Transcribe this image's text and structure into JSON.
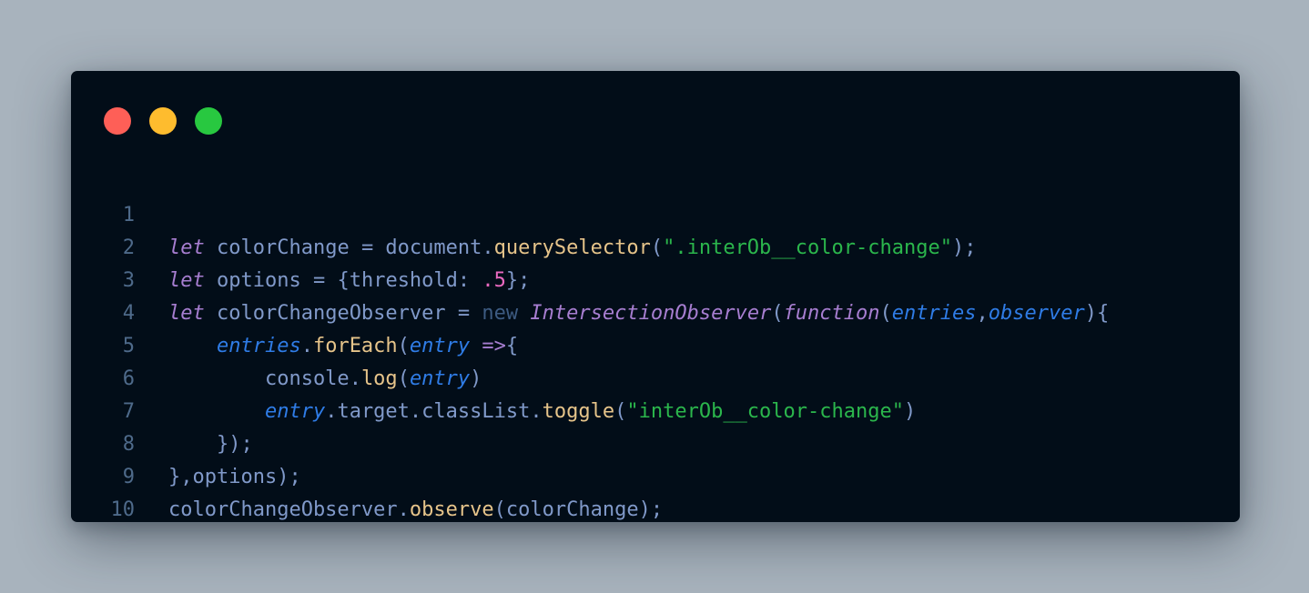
{
  "window": {
    "controls": [
      {
        "name": "close",
        "color": "#fe5f57"
      },
      {
        "name": "minimize",
        "color": "#febc2e"
      },
      {
        "name": "maximize",
        "color": "#28c840"
      }
    ]
  },
  "editor": {
    "line_numbers": [
      "1",
      "2",
      "3",
      "4",
      "5",
      "6",
      "7",
      "8",
      "9",
      "10"
    ],
    "lines": [
      {
        "text": "let colorChange = document.querySelector(\".interOb__color-change\");"
      },
      {
        "text": "let options = {threshold: .5};"
      },
      {
        "text": "let colorChangeObserver = new IntersectionObserver(function(entries,observer){"
      },
      {
        "text": "    entries.forEach(entry =>{"
      },
      {
        "text": "        console.log(entry)"
      },
      {
        "text": "        entry.target.classList.toggle(\"interOb__color-change\")"
      },
      {
        "text": "    });"
      },
      {
        "text": "},options);"
      },
      {
        "text": "colorChangeObserver.observe(colorChange);"
      },
      {
        "text": ""
      }
    ],
    "tokens": {
      "l1": [
        "let",
        " colorChange ",
        "=",
        " document",
        ".",
        "querySelector",
        "(",
        "\".interOb__color-change\"",
        ");"
      ],
      "l2": [
        "let",
        " options ",
        "=",
        " {threshold: ",
        ".5",
        "};"
      ],
      "l3": [
        "let",
        " colorChangeObserver ",
        "=",
        " ",
        "new",
        " ",
        "IntersectionObserver",
        "(",
        "function",
        "(",
        "entries",
        ",",
        "observer",
        "){"
      ],
      "l4": [
        "    ",
        "entries",
        ".",
        "forEach",
        "(",
        "entry",
        " ",
        "=>",
        "{"
      ],
      "l5": [
        "        console",
        ".",
        "log",
        "(",
        "entry",
        ")"
      ],
      "l6": [
        "        ",
        "entry",
        ".target.classList.",
        "toggle",
        "(",
        "\"interOb__color-change\"",
        ")"
      ],
      "l7": [
        "    });"
      ],
      "l8": [
        "},options);"
      ],
      "l9": [
        "colorChangeObserver",
        ".",
        "observe",
        "(colorChange);"
      ]
    }
  }
}
